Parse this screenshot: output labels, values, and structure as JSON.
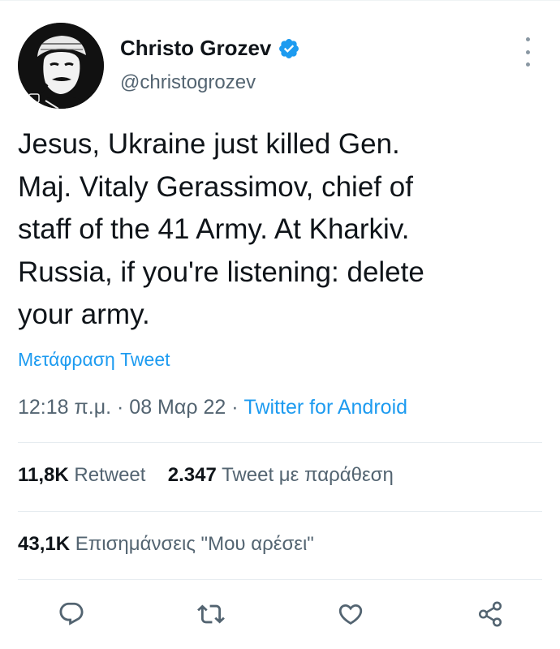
{
  "author": {
    "display_name": "Christo Grozev",
    "handle": "@christogrozev",
    "verified": true
  },
  "tweet": {
    "text": "Jesus, Ukraine just killed Gen.\nMaj. Vitaly Gerassimov, chief of\nstaff of the 41 Army. At Kharkiv.\nRussia, if you're listening: delete\nyour army.",
    "translate_label": "Μετάφραση Tweet",
    "time": "12:18 π.μ.",
    "separator": "·",
    "date": "08 Μαρ 22",
    "source": "Twitter for Android"
  },
  "stats": {
    "retweets_count": "11,8K",
    "retweets_label": "Retweet",
    "quotes_count": "2.347",
    "quotes_label": "Tweet με παράθεση",
    "likes_count": "43,1K",
    "likes_label": "Επισημάνσεις \"Μου αρέσει\""
  },
  "icons": {
    "verified": "verified-badge-icon",
    "more": "more-vertical-icon",
    "reply": "reply-icon",
    "retweet": "retweet-icon",
    "like": "heart-icon",
    "share": "share-icon"
  },
  "colors": {
    "accent": "#1d9bf0",
    "text": "#0f1419",
    "secondary": "#536471",
    "divider": "#e6ecf0"
  }
}
